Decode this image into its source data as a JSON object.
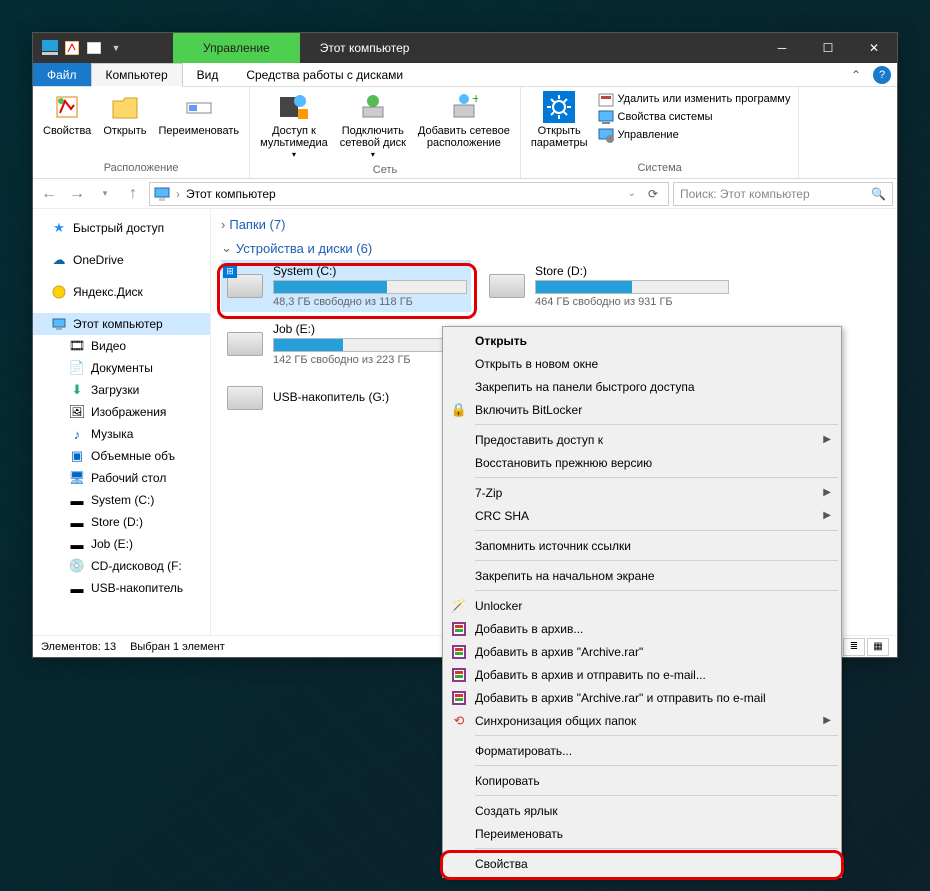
{
  "titlebar": {
    "mgmt_tab": "Управление",
    "title": "Этот компьютер"
  },
  "tabs": {
    "file": "Файл",
    "computer": "Компьютер",
    "view": "Вид",
    "disk_tools": "Средства работы с дисками"
  },
  "ribbon": {
    "properties": "Свойства",
    "open": "Открыть",
    "rename": "Переименовать",
    "group_location": "Расположение",
    "media": "Доступ к\nмультимедиа",
    "map_drive": "Подключить\nсетевой диск",
    "add_net": "Добавить сетевое\nрасположение",
    "group_network": "Сеть",
    "settings": "Открыть\nпараметры",
    "uninstall": "Удалить или изменить программу",
    "sys_props": "Свойства системы",
    "manage": "Управление",
    "group_system": "Система"
  },
  "address": {
    "path": "Этот компьютер",
    "search_placeholder": "Поиск: Этот компьютер"
  },
  "nav": {
    "quick": "Быстрый доступ",
    "onedrive": "OneDrive",
    "yadisk": "Яндекс.Диск",
    "thispc": "Этот компьютер",
    "video": "Видео",
    "docs": "Документы",
    "downloads": "Загрузки",
    "pics": "Изображения",
    "music": "Музыка",
    "objects3d": "Объемные объ",
    "desktop": "Рабочий стол",
    "sysC": "System (C:)",
    "storeD": "Store (D:)",
    "jobE": "Job (E:)",
    "cd": "CD-дисковод (F:",
    "usb": "USB-накопитель"
  },
  "content": {
    "folders_header": "Папки (7)",
    "drives_header": "Устройства и диски (6)",
    "drives": [
      {
        "name": "System (C:)",
        "free": "48,3 ГБ свободно из 118 ГБ",
        "pct": 59,
        "win": true
      },
      {
        "name": "Store (D:)",
        "free": "464 ГБ свободно из 931 ГБ",
        "pct": 50,
        "win": false
      },
      {
        "name": "Job (E:)",
        "free": "142 ГБ свободно из 223 ГБ",
        "pct": 36,
        "win": false
      }
    ],
    "usb_label": "USB-накопитель (G:)"
  },
  "status": {
    "count": "Элементов: 13",
    "selected": "Выбран 1 элемент"
  },
  "ctx": {
    "open": "Открыть",
    "open_new": "Открыть в новом окне",
    "pin_qa": "Закрепить на панели быстрого доступа",
    "bitlocker": "Включить BitLocker",
    "share": "Предоставить доступ к",
    "restore": "Восстановить прежнюю версию",
    "7zip": "7-Zip",
    "crc": "CRC SHA",
    "remember": "Запомнить источник ссылки",
    "pin_start": "Закрепить на начальном экране",
    "unlocker": "Unlocker",
    "addarch": "Добавить в архив...",
    "addrar": "Добавить в архив \"Archive.rar\"",
    "addmail": "Добавить в архив и отправить по e-mail...",
    "addrarmail": "Добавить в архив \"Archive.rar\" и отправить по e-mail",
    "sync": "Синхронизация общих папок",
    "format": "Форматировать...",
    "copy": "Копировать",
    "shortcut": "Создать ярлык",
    "rename": "Переименовать",
    "properties": "Свойства"
  }
}
